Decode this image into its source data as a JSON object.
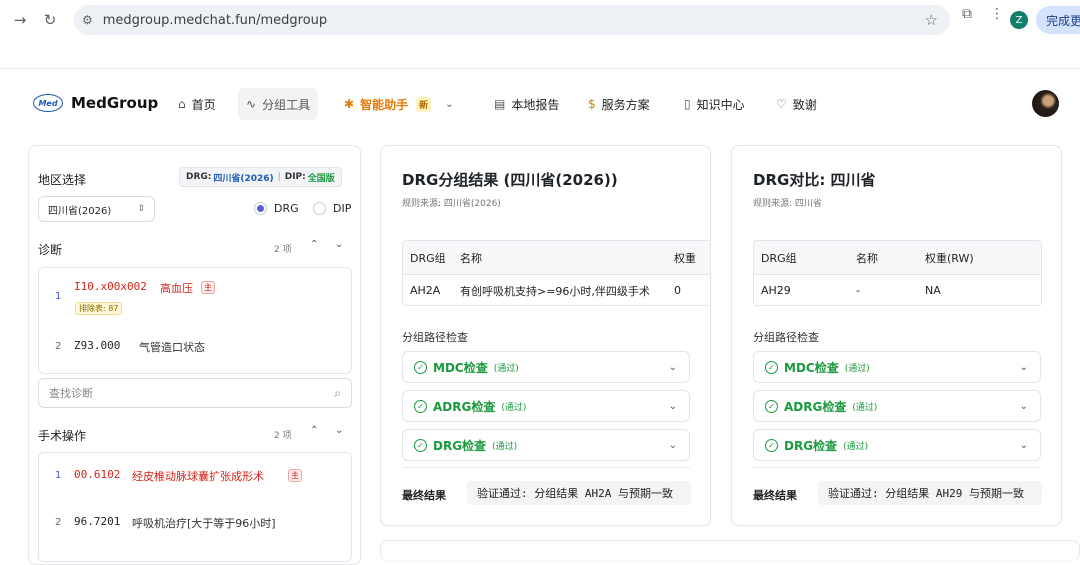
{
  "browser": {
    "url": "medgroup.medchat.fun/medgroup",
    "profile_initial": "Z",
    "complete_button": "完成更"
  },
  "header": {
    "logo_mark": "Med",
    "logo_text": "MedGroup",
    "menu": [
      {
        "label": "首页",
        "icon": "home-icon"
      },
      {
        "label": "分组工具",
        "icon": "pulse-icon"
      },
      {
        "label": "智能助手",
        "icon": "sparkle-icon",
        "badge": "新"
      },
      {
        "label": "本地报告",
        "icon": "document-icon"
      },
      {
        "label": "服务方案",
        "icon": "moneybag-icon"
      },
      {
        "label": "知识中心",
        "icon": "book-icon"
      },
      {
        "label": "致谢",
        "icon": "heart-icon"
      }
    ]
  },
  "left": {
    "region_label": "地区选择",
    "badge_drg_prefix": "DRG:",
    "badge_drg_value": "四川省(2026)",
    "badge_sep": "|",
    "badge_dip_prefix": "DIP:",
    "badge_dip_value": "全国版",
    "region_select": "四川省(2026)",
    "radio_drg": "DRG",
    "radio_dip": "DIP",
    "diagnosis_label": "诊断",
    "diagnosis_count": "2 项",
    "diagnoses": [
      {
        "num": "1",
        "code": "I10.x00x002",
        "name": "高血压",
        "main": "主",
        "excl": "排除表: 87"
      },
      {
        "num": "2",
        "code": "Z93.000",
        "name": "气管造口状态"
      }
    ],
    "search_placeholder": "查找诊断",
    "procedure_label": "手术操作",
    "procedure_count": "2 项",
    "procedures": [
      {
        "num": "1",
        "code": "00.6102",
        "name": "经皮椎动脉球囊扩张成形术",
        "main": "主"
      },
      {
        "num": "2",
        "code": "96.7201",
        "name": "呼吸机治疗[大于等于96小时]"
      }
    ]
  },
  "result": {
    "title": "DRG分组结果 (四川省(2026))",
    "source": "规则来源: 四川省(2026)",
    "table_headers": [
      "DRG组",
      "名称",
      "权重"
    ],
    "table_row": [
      "AH2A",
      "有创呼吸机支持>=96小时,伴四级手术",
      "0"
    ],
    "path_label": "分组路径检查",
    "checks": [
      {
        "name": "MDC检查",
        "status": "(通过)"
      },
      {
        "name": "ADRG检查",
        "status": "(通过)"
      },
      {
        "name": "DRG检查",
        "status": "(通过)"
      }
    ],
    "final_label": "最终结果",
    "final_value": "验证通过: 分组结果 AH2A 与预期一致"
  },
  "compare": {
    "title": "DRG对比: 四川省",
    "source": "规则来源: 四川省",
    "table_headers": [
      "DRG组",
      "名称",
      "权重(RW)"
    ],
    "table_row": [
      "AH29",
      "-",
      "NA"
    ],
    "path_label": "分组路径检查",
    "checks": [
      {
        "name": "MDC检查",
        "status": "(通过)"
      },
      {
        "name": "ADRG检查",
        "status": "(通过)"
      },
      {
        "name": "DRG检查",
        "status": "(通过)"
      }
    ],
    "final_label": "最终结果",
    "final_value": "验证通过: 分组结果 AH29 与预期一致"
  }
}
